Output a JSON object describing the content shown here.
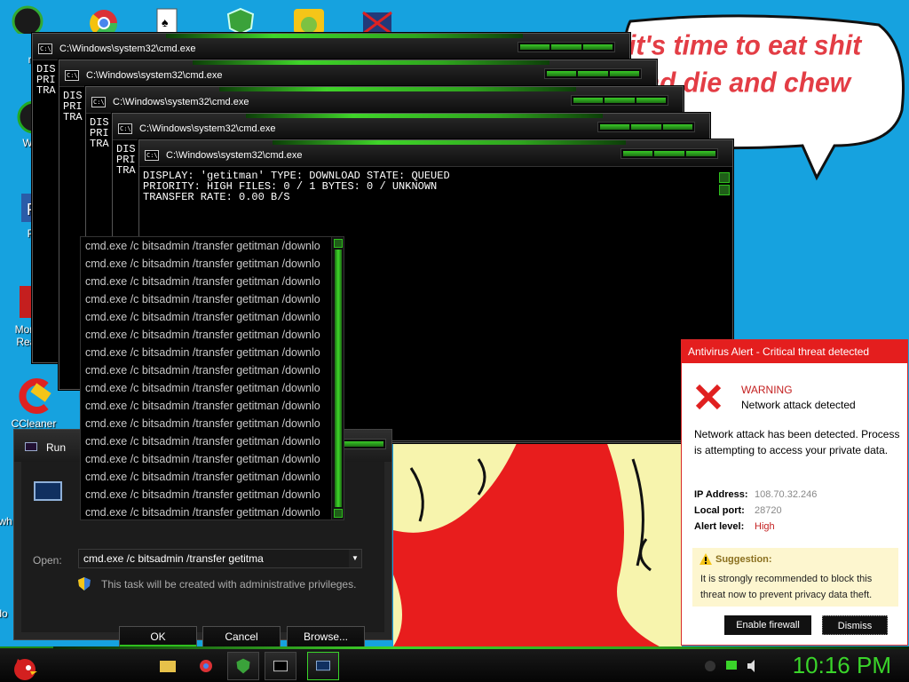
{
  "desktop": {
    "icons": [
      {
        "label": "mi",
        "name": "desktop-icon-mi"
      },
      {
        "label": "Wi V",
        "name": "desktop-icon-windows-v"
      },
      {
        "label": "Po",
        "name": "desktop-icon-po"
      },
      {
        "label": "Morbius Reader",
        "name": "desktop-icon-morbius-reader"
      },
      {
        "label": "CCleaner",
        "name": "desktop-icon-ccleaner"
      },
      {
        "label": "wh",
        "name": "desktop-icon-wh"
      },
      {
        "label": "do",
        "name": "desktop-icon-do"
      }
    ],
    "bubble_text": "it's time to eat shit and die and chew gum"
  },
  "cmd_windows": {
    "title": "C:\\Windows\\system32\\cmd.exe",
    "main_output": [
      "DISPLAY: 'getitman' TYPE: DOWNLOAD STATE: QUEUED",
      "PRIORITY: HIGH FILES: 0 / 1 BYTES: 0 / UNKNOWN",
      "TRANSFER RATE: 0.00 B/S"
    ],
    "back_output": [
      "DIS",
      "PRI",
      "TRA"
    ]
  },
  "autocomplete": {
    "item_text": "cmd.exe /c bitsadmin /transfer getitman /downlo",
    "count": 16
  },
  "run_dialog": {
    "title": "Run",
    "open_label": "Open:",
    "open_value": "cmd.exe /c bitsadmin /transfer getitma",
    "privilege_note": "This task will be created with administrative privileges.",
    "ok_label": "OK",
    "cancel_label": "Cancel",
    "browse_label": "Browse..."
  },
  "antivirus": {
    "header": "Antivirus Alert - Critical threat detected",
    "warning": "WARNING",
    "subtitle": "Network attack detected",
    "message": "Network attack has been detected. Process is attempting to access your private data.",
    "ip_label": "IP Address:",
    "ip_value": "108.70.32.246",
    "port_label": "Local port:",
    "port_value": "28720",
    "level_label": "Alert level:",
    "level_value": "High",
    "suggestion_title": "Suggestion:",
    "suggestion_text": "It is strongly recommended to block this threat now to prevent privacy data theft.",
    "enable_label": "Enable firewall",
    "dismiss_label": "Dismiss",
    "accent": "#e41e1e"
  },
  "taskbar": {
    "clock": "10:16 PM",
    "accent": "#3ad42a"
  }
}
